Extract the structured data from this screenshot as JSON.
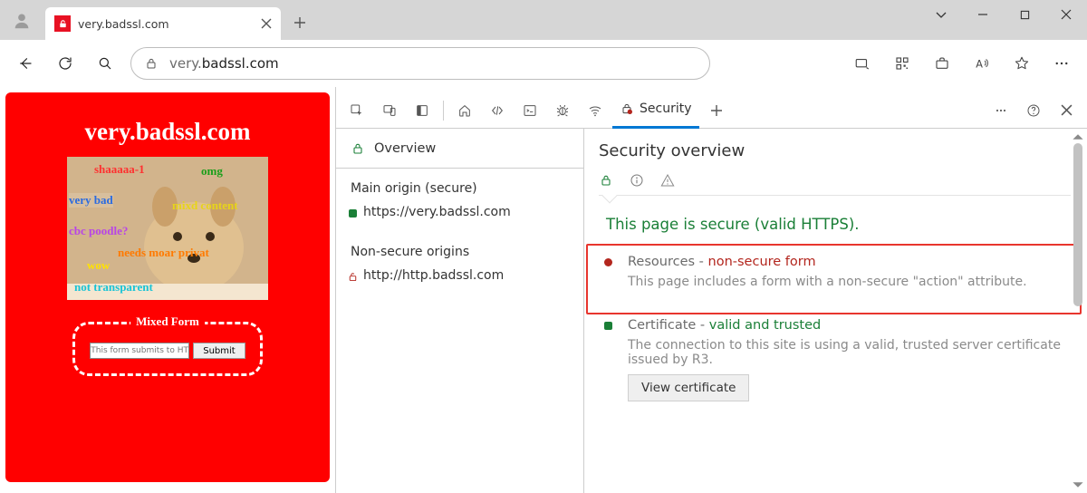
{
  "tab": {
    "title": "very.badssl.com"
  },
  "address": {
    "prefix": "very.",
    "host": "badssl.com"
  },
  "page": {
    "title": "very.badssl.com",
    "memes": {
      "sha": "shaaaaa-1",
      "omg": "omg",
      "verybad": "very bad",
      "mixd": "mixd content",
      "cbc": "cbc poodle?",
      "moar": "needs moar privat",
      "wow": "wow",
      "transparent": "not transparent"
    },
    "mixed_form_label": "Mixed Form",
    "mixed_form_placeholder": "This form submits to HTTP.",
    "submit_label": "Submit"
  },
  "devtools": {
    "security_tab": "Security",
    "overview": "Overview",
    "main_origin_header": "Main origin (secure)",
    "main_origin_url": "https://very.badssl.com",
    "nonsecure_header": "Non-secure origins",
    "nonsecure_url": "http://http.badssl.com",
    "overview_title": "Security overview",
    "secure_line": "This page is secure (valid HTTPS).",
    "resources_label": "Resources - ",
    "resources_status": "non-secure form",
    "resources_desc": "This page includes a form with a non-secure \"action\" attribute.",
    "cert_label": "Certificate - ",
    "cert_status": "valid and trusted",
    "cert_desc": "The connection to this site is using a valid, trusted server certificate issued by R3.",
    "view_cert": "View certificate"
  }
}
